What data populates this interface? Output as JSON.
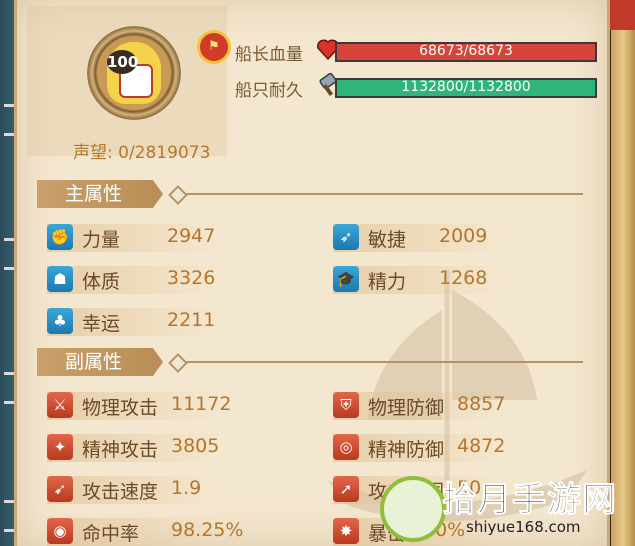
{
  "captain": {
    "level": "100",
    "prestige": "声望: 0/2819073"
  },
  "bars": [
    {
      "label": "船长血量",
      "text": "68673/68673",
      "fill": 1.0,
      "color": "#d6453a",
      "icon": "heart-icon"
    },
    {
      "label": "船只耐久",
      "text": "1132800/1132800",
      "fill": 1.0,
      "color": "#2fb57a",
      "icon": "hammer-icon"
    }
  ],
  "main_attrs": {
    "title": "主属性",
    "items": [
      {
        "name": "力量",
        "value": "2947",
        "icon": "fist-icon"
      },
      {
        "name": "敏捷",
        "value": "2009",
        "icon": "swift-icon"
      },
      {
        "name": "体质",
        "value": "3326",
        "icon": "body-icon"
      },
      {
        "name": "精力",
        "value": "1268",
        "icon": "scholar-cap-icon"
      },
      {
        "name": "幸运",
        "value": "2211",
        "icon": "clover-icon"
      }
    ]
  },
  "sub_attrs": {
    "title": "副属性",
    "items": [
      {
        "name": "物理攻击",
        "value": "11172",
        "icon": "sword-icon"
      },
      {
        "name": "物理防御",
        "value": "8857",
        "icon": "shield-icon"
      },
      {
        "name": "精神攻击",
        "value": "3805",
        "icon": "magic-attack-icon"
      },
      {
        "name": "精神防御",
        "value": "4872",
        "icon": "magic-defense-icon"
      },
      {
        "name": "攻击速度",
        "value": "1.9",
        "icon": "speed-icon"
      },
      {
        "name": "攻击范围",
        "value": "50",
        "icon": "range-icon"
      },
      {
        "name": "命中率",
        "value": "98.25%",
        "icon": "accuracy-icon"
      },
      {
        "name": "暴击",
        "value": "30%",
        "icon": "crit-icon"
      }
    ]
  },
  "watermark": {
    "title": "拾月手游网",
    "url": "shiyue168.com"
  }
}
